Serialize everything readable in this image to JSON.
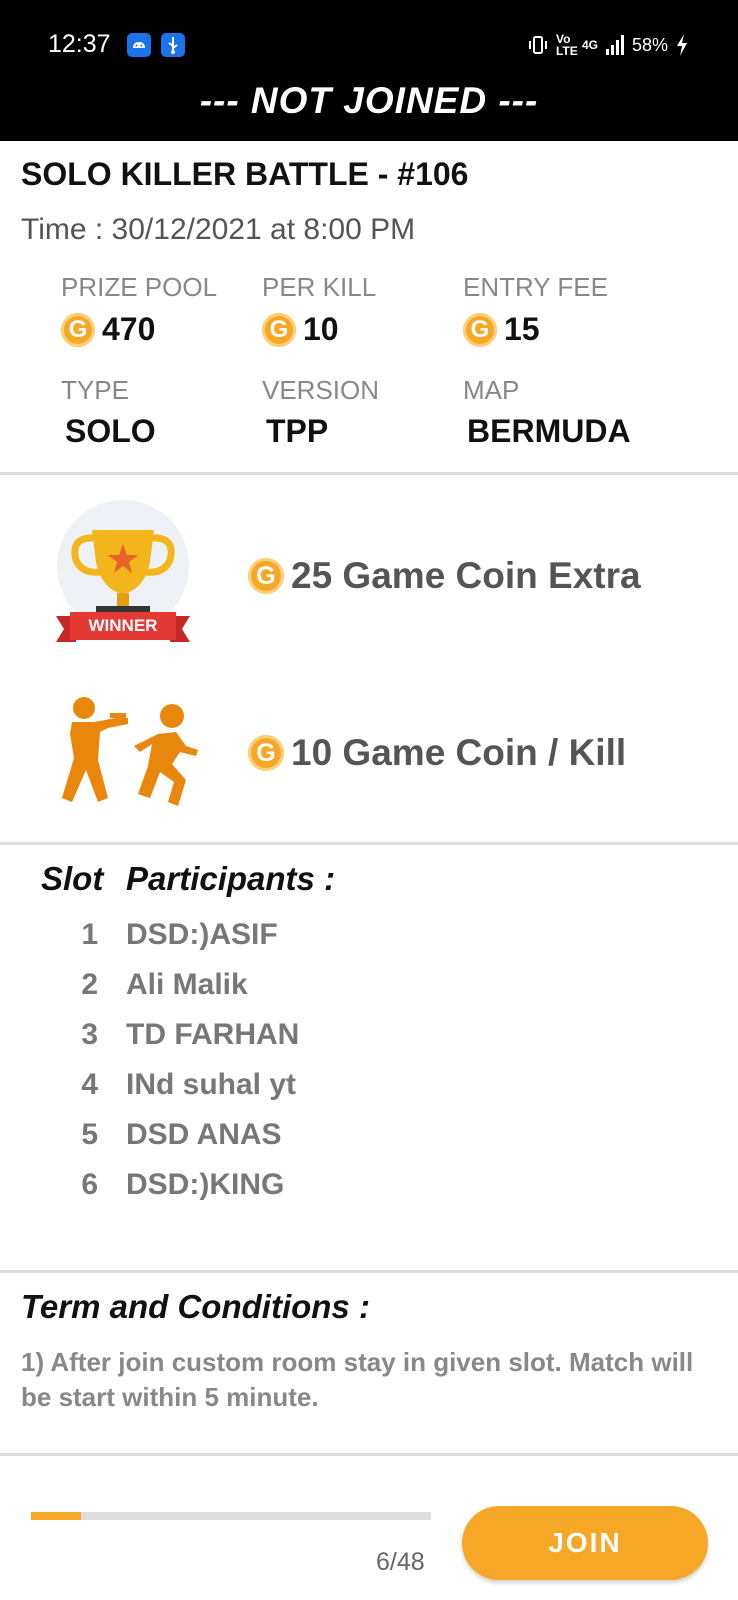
{
  "status_bar": {
    "time": "12:37",
    "network_volte": "Vo LTE",
    "network_type": "4G",
    "battery": "58%"
  },
  "banner": "--- NOT JOINED ---",
  "match": {
    "title": "SOLO KILLER BATTLE - #106",
    "time": "Time : 30/12/2021 at 8:00 PM"
  },
  "stats": {
    "prize_pool_label": "PRIZE POOL",
    "prize_pool": "470",
    "per_kill_label": "PER KILL",
    "per_kill": "10",
    "entry_fee_label": "ENTRY FEE",
    "entry_fee": "15",
    "type_label": "TYPE",
    "type": "SOLO",
    "version_label": "VERSION",
    "version": "TPP",
    "map_label": "MAP",
    "map": "BERMUDA"
  },
  "coin_glyph": "G",
  "rewards": {
    "winner_badge": "WINNER",
    "winner_reward": "25 Game Coin Extra",
    "kill_reward": "10 Game Coin / Kill"
  },
  "participants": {
    "slot_header": "Slot",
    "participants_header": "Participants :",
    "list": [
      {
        "slot": "1",
        "name": "DSD:)ASIF"
      },
      {
        "slot": "2",
        "name": "Ali Malik"
      },
      {
        "slot": "3",
        "name": "TD FARHAN"
      },
      {
        "slot": "4",
        "name": "INd suhal yt"
      },
      {
        "slot": "5",
        "name": "DSD ANAS"
      },
      {
        "slot": "6",
        "name": "DSD:)KING"
      }
    ]
  },
  "terms": {
    "title": "Term and Conditions :",
    "body": "1) After join custom room stay in given slot. Match will be start within 5 minute."
  },
  "footer": {
    "slots_filled": 6,
    "slots_total": 48,
    "count_text": "6/48",
    "join_label": "JOIN"
  },
  "colors": {
    "accent": "#f7a726",
    "header_bg": "#000000",
    "runner": "#e8870c",
    "ribbon": "#e53935"
  }
}
